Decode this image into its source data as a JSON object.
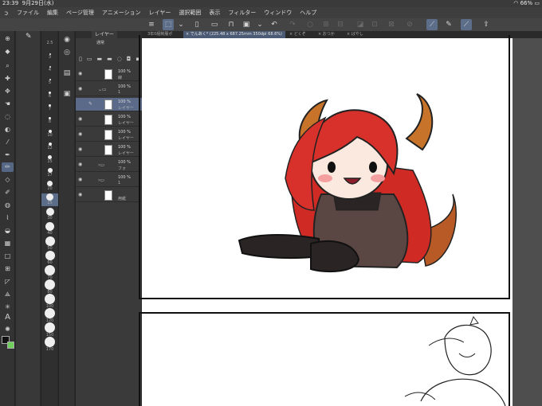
{
  "status": {
    "time": "23:39",
    "date": "9月29日(水)",
    "battery": "66%"
  },
  "menu": [
    "ファイル",
    "編集",
    "ページ管理",
    "アニメーション",
    "レイヤー",
    "選択範囲",
    "表示",
    "フィルター",
    "ウィンドウ",
    "ヘルプ"
  ],
  "tabs": [
    "3年0組制服ポ",
    "× でんあく* (225.48 x 687.25mm 350dpi 68.6%)",
    "× どくぞ",
    "× おつか",
    "× ばやし"
  ],
  "layer_panel": {
    "tab": "レイヤー",
    "blend": "通常",
    "rows": [
      {
        "pct": "100 %",
        "name": "線"
      },
      {
        "pct": "100 %",
        "name": "1"
      },
      {
        "pct": "100 %",
        "name": "レイヤー"
      },
      {
        "pct": "100 %",
        "name": "レイヤー"
      },
      {
        "pct": "100 %",
        "name": "レイヤー"
      },
      {
        "pct": "100 %",
        "name": "レイヤー"
      },
      {
        "pct": "100 %",
        "name": "フォ"
      },
      {
        "pct": "100 %",
        "name": "1"
      },
      {
        "pct": "",
        "name": "用紙"
      }
    ]
  },
  "brush_sizes": [
    "2.5",
    "3",
    "4",
    "5",
    "6",
    "7",
    "8",
    "10",
    "12",
    "15",
    "17",
    "20",
    "25",
    "30",
    "40",
    "50",
    "60",
    "70",
    "80",
    "100",
    "120",
    "150",
    "170"
  ],
  "accent": "#5c6d89"
}
